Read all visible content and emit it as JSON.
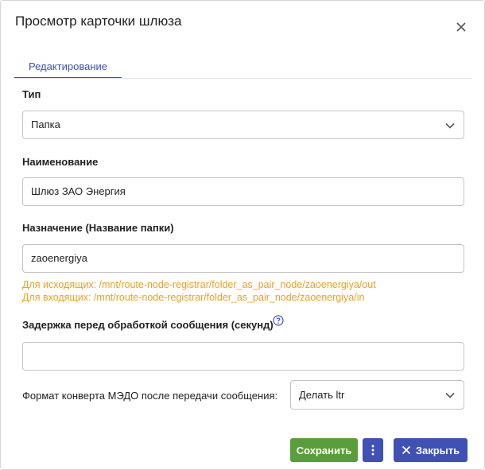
{
  "dialog": {
    "title": "Просмотр карточки шлюза",
    "close_icon": "close-icon"
  },
  "tabs": [
    {
      "label": "Редактирование",
      "active": true
    }
  ],
  "form": {
    "type": {
      "label": "Тип",
      "value": "Папка"
    },
    "name": {
      "label": "Наименование",
      "value": "Шлюз ЗАО Энергия"
    },
    "destination": {
      "label": "Назначение (Название папки)",
      "value": "zaoenergiya",
      "hint_out": "Для исходящих: /mnt/route-node-registrar/folder_as_pair_node/zaoenergiya/out",
      "hint_in": "Для входящих: /mnt/route-node-registrar/folder_as_pair_node/zaoenergiya/in"
    },
    "delay": {
      "label": "Задержка перед обработкой сообщения (секунд)",
      "value": "",
      "help_icon": "question-circle-icon"
    },
    "envelope_format": {
      "label": "Формат конверта МЭДО после передачи сообщения:",
      "value": "Делать ltr"
    }
  },
  "footer": {
    "save_label": "Сохранить",
    "more_icon": "more-vertical-icon",
    "close_label": "Закрыть"
  },
  "colors": {
    "primary": "#3f51b5",
    "success": "#5a9e3a",
    "hint": "#f0a020"
  }
}
